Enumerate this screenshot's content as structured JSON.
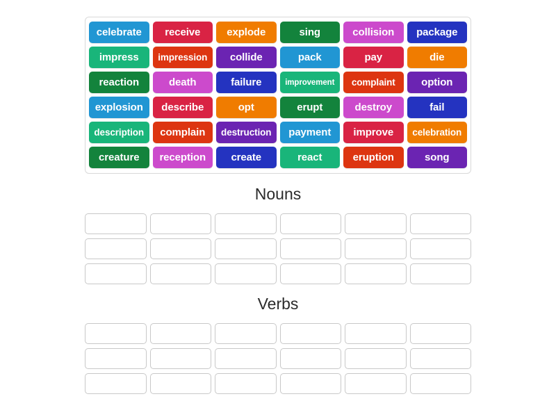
{
  "activity": {
    "type": "group-sort",
    "categories": [
      {
        "id": "nouns",
        "title": "Nouns",
        "rows": 3,
        "columns": 6,
        "slots": [
          [
            "",
            "",
            "",
            "",
            "",
            ""
          ],
          [
            "",
            "",
            "",
            "",
            "",
            ""
          ],
          [
            "",
            "",
            "",
            "",
            "",
            ""
          ]
        ]
      },
      {
        "id": "verbs",
        "title": "Verbs",
        "rows": 3,
        "columns": 6,
        "slots": [
          [
            "",
            "",
            "",
            "",
            "",
            ""
          ],
          [
            "",
            "",
            "",
            "",
            "",
            ""
          ],
          [
            "",
            "",
            "",
            "",
            "",
            ""
          ]
        ]
      }
    ]
  },
  "word_bank": {
    "rows": [
      [
        {
          "label": "celebrate",
          "color": "#2196d3",
          "size": "normal"
        },
        {
          "label": "receive",
          "color": "#d92344",
          "size": "normal"
        },
        {
          "label": "explode",
          "color": "#f07c00",
          "size": "normal"
        },
        {
          "label": "sing",
          "color": "#13833c",
          "size": "normal"
        },
        {
          "label": "collision",
          "color": "#cc4acc",
          "size": "normal"
        },
        {
          "label": "package",
          "color": "#2433c0",
          "size": "normal"
        }
      ],
      [
        {
          "label": "impress",
          "color": "#19b57a",
          "size": "normal"
        },
        {
          "label": "impression",
          "color": "#dd3511",
          "size": "medium"
        },
        {
          "label": "collide",
          "color": "#6b24b2",
          "size": "normal"
        },
        {
          "label": "pack",
          "color": "#2196d3",
          "size": "normal"
        },
        {
          "label": "pay",
          "color": "#d92344",
          "size": "normal"
        },
        {
          "label": "die",
          "color": "#f07c00",
          "size": "normal"
        }
      ],
      [
        {
          "label": "reaction",
          "color": "#13833c",
          "size": "normal"
        },
        {
          "label": "death",
          "color": "#cc4acc",
          "size": "normal"
        },
        {
          "label": "failure",
          "color": "#2433c0",
          "size": "normal"
        },
        {
          "label": "improvement",
          "color": "#19b57a",
          "size": "small"
        },
        {
          "label": "complaint",
          "color": "#dd3511",
          "size": "medium"
        },
        {
          "label": "option",
          "color": "#6b24b2",
          "size": "normal"
        }
      ],
      [
        {
          "label": "explosion",
          "color": "#2196d3",
          "size": "normal"
        },
        {
          "label": "describe",
          "color": "#d92344",
          "size": "normal"
        },
        {
          "label": "opt",
          "color": "#f07c00",
          "size": "normal"
        },
        {
          "label": "erupt",
          "color": "#13833c",
          "size": "normal"
        },
        {
          "label": "destroy",
          "color": "#cc4acc",
          "size": "normal"
        },
        {
          "label": "fail",
          "color": "#2433c0",
          "size": "normal"
        }
      ],
      [
        {
          "label": "description",
          "color": "#19b57a",
          "size": "medium"
        },
        {
          "label": "complain",
          "color": "#dd3511",
          "size": "normal"
        },
        {
          "label": "destruction",
          "color": "#6b24b2",
          "size": "medium"
        },
        {
          "label": "payment",
          "color": "#2196d3",
          "size": "normal"
        },
        {
          "label": "improve",
          "color": "#d92344",
          "size": "normal"
        },
        {
          "label": "celebration",
          "color": "#f07c00",
          "size": "medium"
        }
      ],
      [
        {
          "label": "creature",
          "color": "#13833c",
          "size": "normal"
        },
        {
          "label": "reception",
          "color": "#cc4acc",
          "size": "normal"
        },
        {
          "label": "create",
          "color": "#2433c0",
          "size": "normal"
        },
        {
          "label": "react",
          "color": "#19b57a",
          "size": "normal"
        },
        {
          "label": "eruption",
          "color": "#dd3511",
          "size": "normal"
        },
        {
          "label": "song",
          "color": "#6b24b2",
          "size": "normal"
        }
      ]
    ]
  }
}
